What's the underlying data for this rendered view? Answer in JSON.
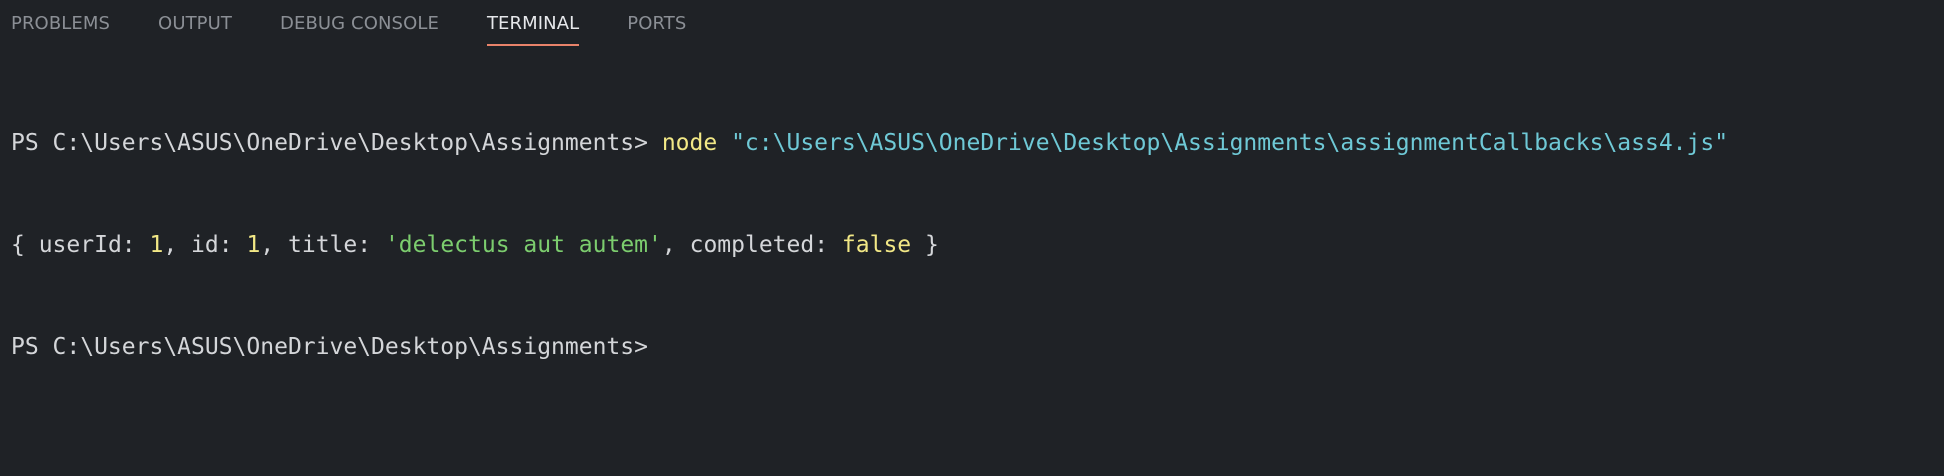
{
  "tabs": [
    {
      "label": "PROBLEMS",
      "active": false
    },
    {
      "label": "OUTPUT",
      "active": false
    },
    {
      "label": "DEBUG CONSOLE",
      "active": false
    },
    {
      "label": "TERMINAL",
      "active": true
    },
    {
      "label": "PORTS",
      "active": false
    }
  ],
  "terminal": {
    "line1": {
      "prompt": "PS C:\\Users\\ASUS\\OneDrive\\Desktop\\Assignments> ",
      "command": "node",
      "argument": "\"c:\\Users\\ASUS\\OneDrive\\Desktop\\Assignments\\assignmentCallbacks\\ass4.js\""
    },
    "line2": {
      "open_brace": "{ ",
      "key_userId": "userId: ",
      "val_userId": "1",
      "sep1": ", ",
      "key_id": "id: ",
      "val_id": "1",
      "sep2": ", ",
      "key_title": "title: ",
      "val_title": "'delectus aut autem'",
      "sep3": ", ",
      "key_completed": "completed: ",
      "val_completed": "false",
      "close_brace": " }"
    },
    "line3": {
      "prompt": "PS C:\\Users\\ASUS\\OneDrive\\Desktop\\Assignments>"
    }
  },
  "colors": {
    "background": "#1f2226",
    "active_tab_underline": "#e8836a",
    "command": "#f2e886",
    "path_string": "#6fc9d6",
    "single_quoted_string": "#7ccd6e"
  }
}
